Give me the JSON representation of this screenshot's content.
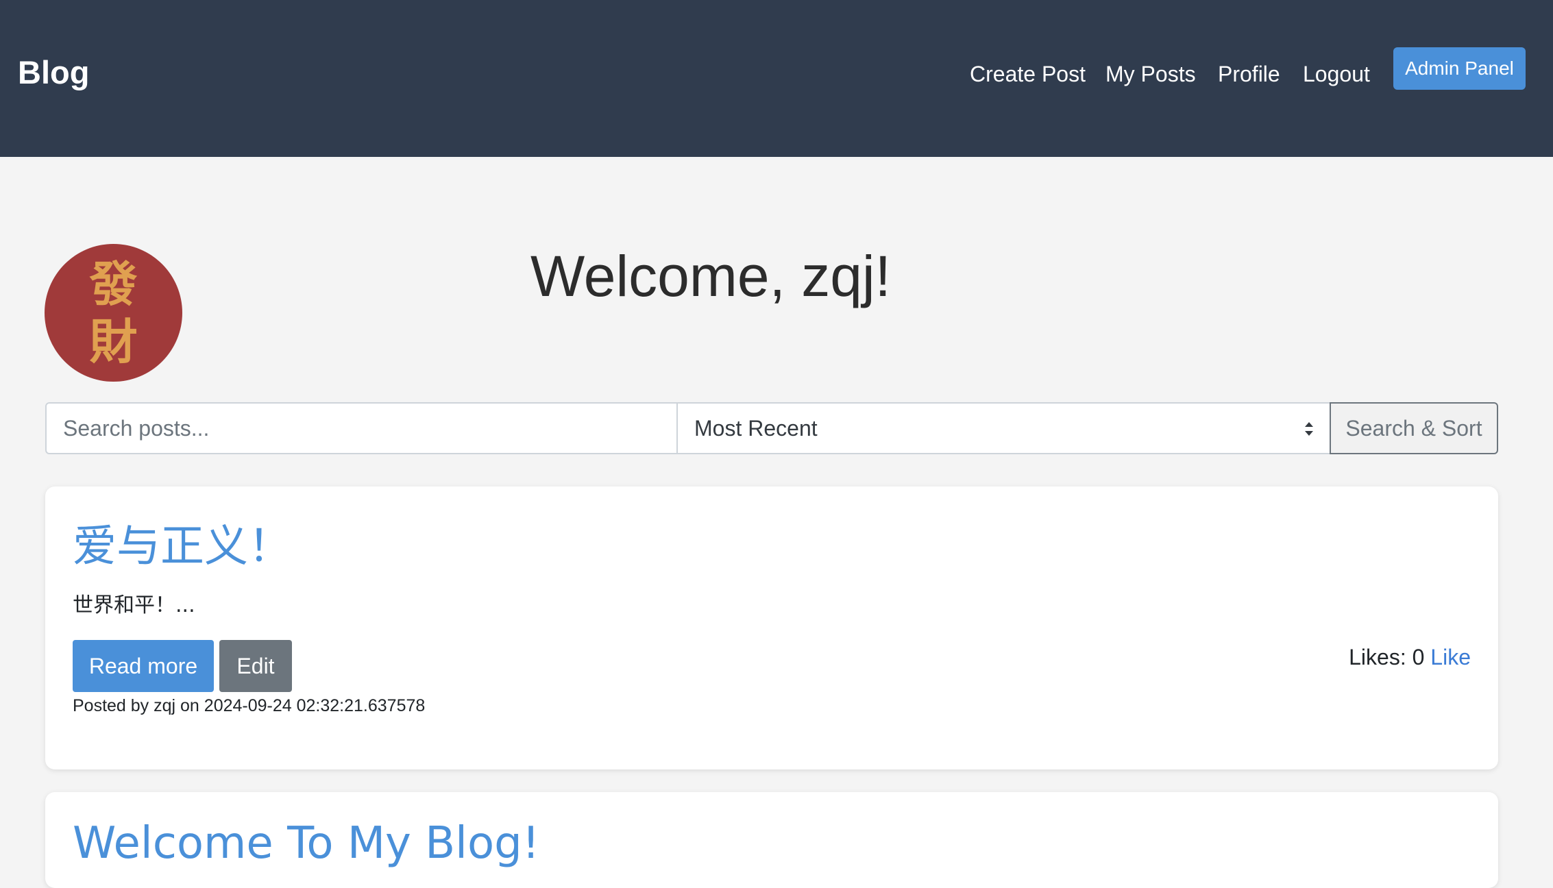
{
  "navbar": {
    "brand": "Blog",
    "links": [
      "Create Post",
      "My Posts",
      "Profile",
      "Logout"
    ],
    "admin_button": "Admin Panel",
    "background": "#303c4e"
  },
  "avatar": {
    "line1": "發",
    "line2": "財",
    "background": "#a03a3a",
    "text_color": "#e0a050"
  },
  "welcome": "Welcome, zqj!",
  "search": {
    "placeholder": "Search posts...",
    "sort_selected": "Most Recent",
    "button": "Search & Sort"
  },
  "posts": [
    {
      "title": "爱与正义！",
      "excerpt": "世界和平！...",
      "read_more": "Read more",
      "edit": "Edit",
      "likes_label": "Likes: 0",
      "like_link": "Like",
      "posted": "Posted by zqj on 2024-09-24 02:32:21.637578"
    },
    {
      "title": "Welcome To My Blog!"
    }
  ],
  "colors": {
    "accent": "#4a90d9",
    "secondary": "#6c757d",
    "page_background": "#f4f4f4"
  }
}
